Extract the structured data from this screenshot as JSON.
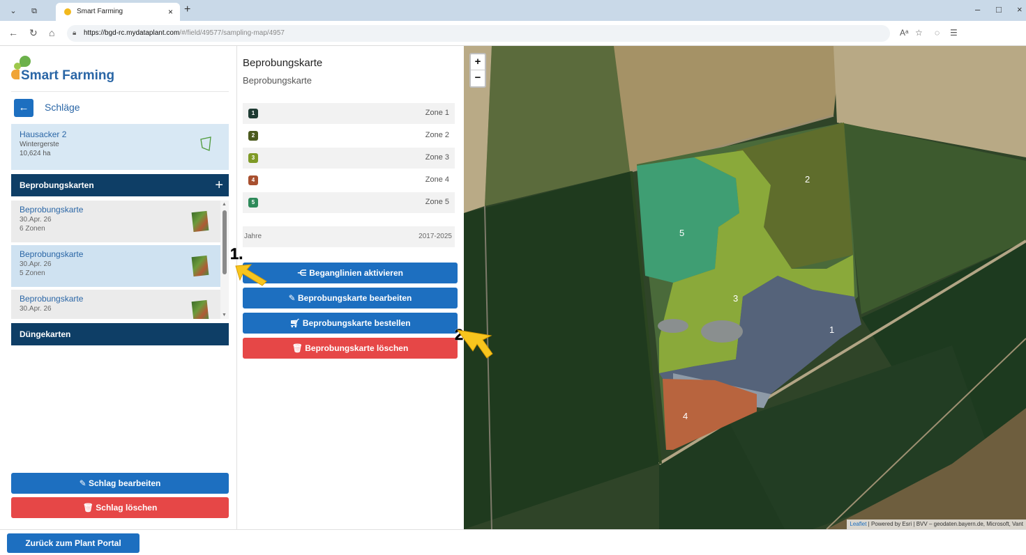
{
  "browser": {
    "tab_title": "Smart Farming",
    "tab_close": "×",
    "new_tab": "+",
    "url_host": "https://bgd-rc.mydataplant.com",
    "url_path": "/#/field/49577/sampling-map/4957",
    "window_minimize": "–",
    "window_maximize": "□",
    "window_close": "×"
  },
  "logo": {
    "text": "Smart Farming"
  },
  "left": {
    "back_label": "Schläge",
    "field": {
      "name": "Hausacker 2",
      "crop": "Wintergerste",
      "area": "10,624 ha"
    },
    "sampling_section": "Beprobungskarten",
    "sampling_cards": [
      {
        "title": "Beprobungskarte",
        "date": "30.Apr. 26",
        "zones": "6 Zonen"
      },
      {
        "title": "Beprobungskarte",
        "date": "30.Apr. 26",
        "zones": "5 Zonen"
      },
      {
        "title": "Beprobungskarte",
        "date": "30.Apr. 26",
        "zones": ""
      }
    ],
    "fertilizer_section": "Düngekarten",
    "edit_field": "Schlag bearbeiten",
    "delete_field": "Schlag löschen"
  },
  "bottom": {
    "portal_button": "Zurück zum Plant Portal"
  },
  "middle": {
    "title": "Beprobungskarte",
    "subtitle": "Beprobungskarte",
    "zones": [
      {
        "num": "1",
        "label": "Zone 1",
        "color": "#1f3b33"
      },
      {
        "num": "2",
        "label": "Zone 2",
        "color": "#4b5a1e"
      },
      {
        "num": "3",
        "label": "Zone 3",
        "color": "#7f9a26"
      },
      {
        "num": "4",
        "label": "Zone 4",
        "color": "#a8502f"
      },
      {
        "num": "5",
        "label": "Zone 5",
        "color": "#2e8a5a"
      }
    ],
    "years_label": "Jahre",
    "years_value": "2017-2025",
    "btn_walklines": "Beganglinien aktivieren",
    "btn_edit": "Beprobungskarte bearbeiten",
    "btn_order": "Beprobungskarte bestellen",
    "btn_delete": "Beprobungskarte löschen"
  },
  "map": {
    "zoom_in": "+",
    "zoom_out": "−",
    "zone_labels": [
      "1",
      "2",
      "3",
      "4",
      "5"
    ],
    "attribution_leaflet": "Leaflet",
    "attribution_rest": " | Powered by Esri | BVV – geodaten.bayern.de, Microsoft, Vant"
  },
  "annotations": {
    "step1": "1.",
    "step2": "2."
  },
  "colors": {
    "primary": "#1d6fc0",
    "danger": "#e64747",
    "navy": "#0e3e66"
  }
}
